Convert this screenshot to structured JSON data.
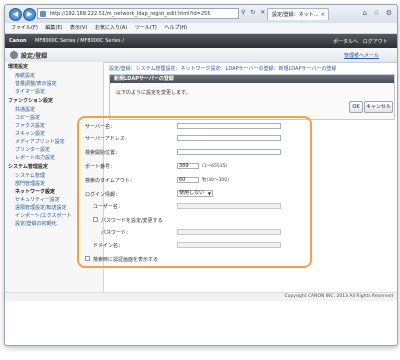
{
  "browser": {
    "url": "http://192.168.222.51/m_network_ldap_regist_edit.html?id=255",
    "tab_title": "設定/登録：ネット…",
    "menu": [
      "ファイル(F)",
      "編集(E)",
      "表示(V)",
      "お気に入り(A)",
      "ツール(T)",
      "ヘルプ(H)"
    ]
  },
  "header": {
    "brand": "Canon",
    "model": "MF8000C Series / MF8000C Series /",
    "portal_link": "ポータルへ",
    "logout_link": "ログアウト",
    "page_title": "設定/登録",
    "admin_link": "管理者へメール"
  },
  "sidebar": {
    "groups": [
      {
        "title": "環境設定",
        "items": [
          "用紙設定",
          "音量調整/表示設定",
          "タイマー設定"
        ]
      },
      {
        "title": "ファンクション設定",
        "items": [
          "共通設定",
          "コピー設定",
          "ファクス設定",
          "スキャン設定",
          "メディアプリント設定",
          "プリンター設定",
          "レポート出力設定"
        ]
      },
      {
        "title": "システム管理設定",
        "items": [
          "システム管理",
          "部門管理設定",
          "ネットワーク設定",
          "セキュリティー設定",
          "遠隔管理設定/転送設定",
          "インポート/エクスポート",
          "設定/登録の初期化"
        ]
      }
    ],
    "active_item": "ネットワーク設定"
  },
  "content": {
    "breadcrumb": "設定/登録：システム管理設定：ネットワーク設定：LDAPサーバーの登録：新規LDAPサーバーの登録",
    "panel_title": "新規LDAPサーバーの登録",
    "message": "以下のように設定を変更します。",
    "ok_label": "OK",
    "cancel_label": "キャンセル"
  },
  "form": {
    "server_name_label": "サーバー名：",
    "server_address_label": "サーバーアドレス：",
    "search_root_label": "検索開始位置：",
    "port_label": "ポート番号：",
    "port_value": "389",
    "port_hint": "(1〜65535)",
    "timeout_label": "検索のタイムアウト：",
    "timeout_value": "60",
    "timeout_hint": "秒(30〜300)",
    "login_label": "ログイン情報：",
    "login_value": "使用しない",
    "user_name_label": "ユーザー名：",
    "set_password_label": "パスワードを設定/変更する",
    "password_label": "パスワード：",
    "domain_label": "ドメイン名：",
    "confirm_label": "検索時に認証画面を表示する"
  },
  "footer": {
    "copyright": "Copyright CANON INC. 2013 All Rights Reserved"
  }
}
